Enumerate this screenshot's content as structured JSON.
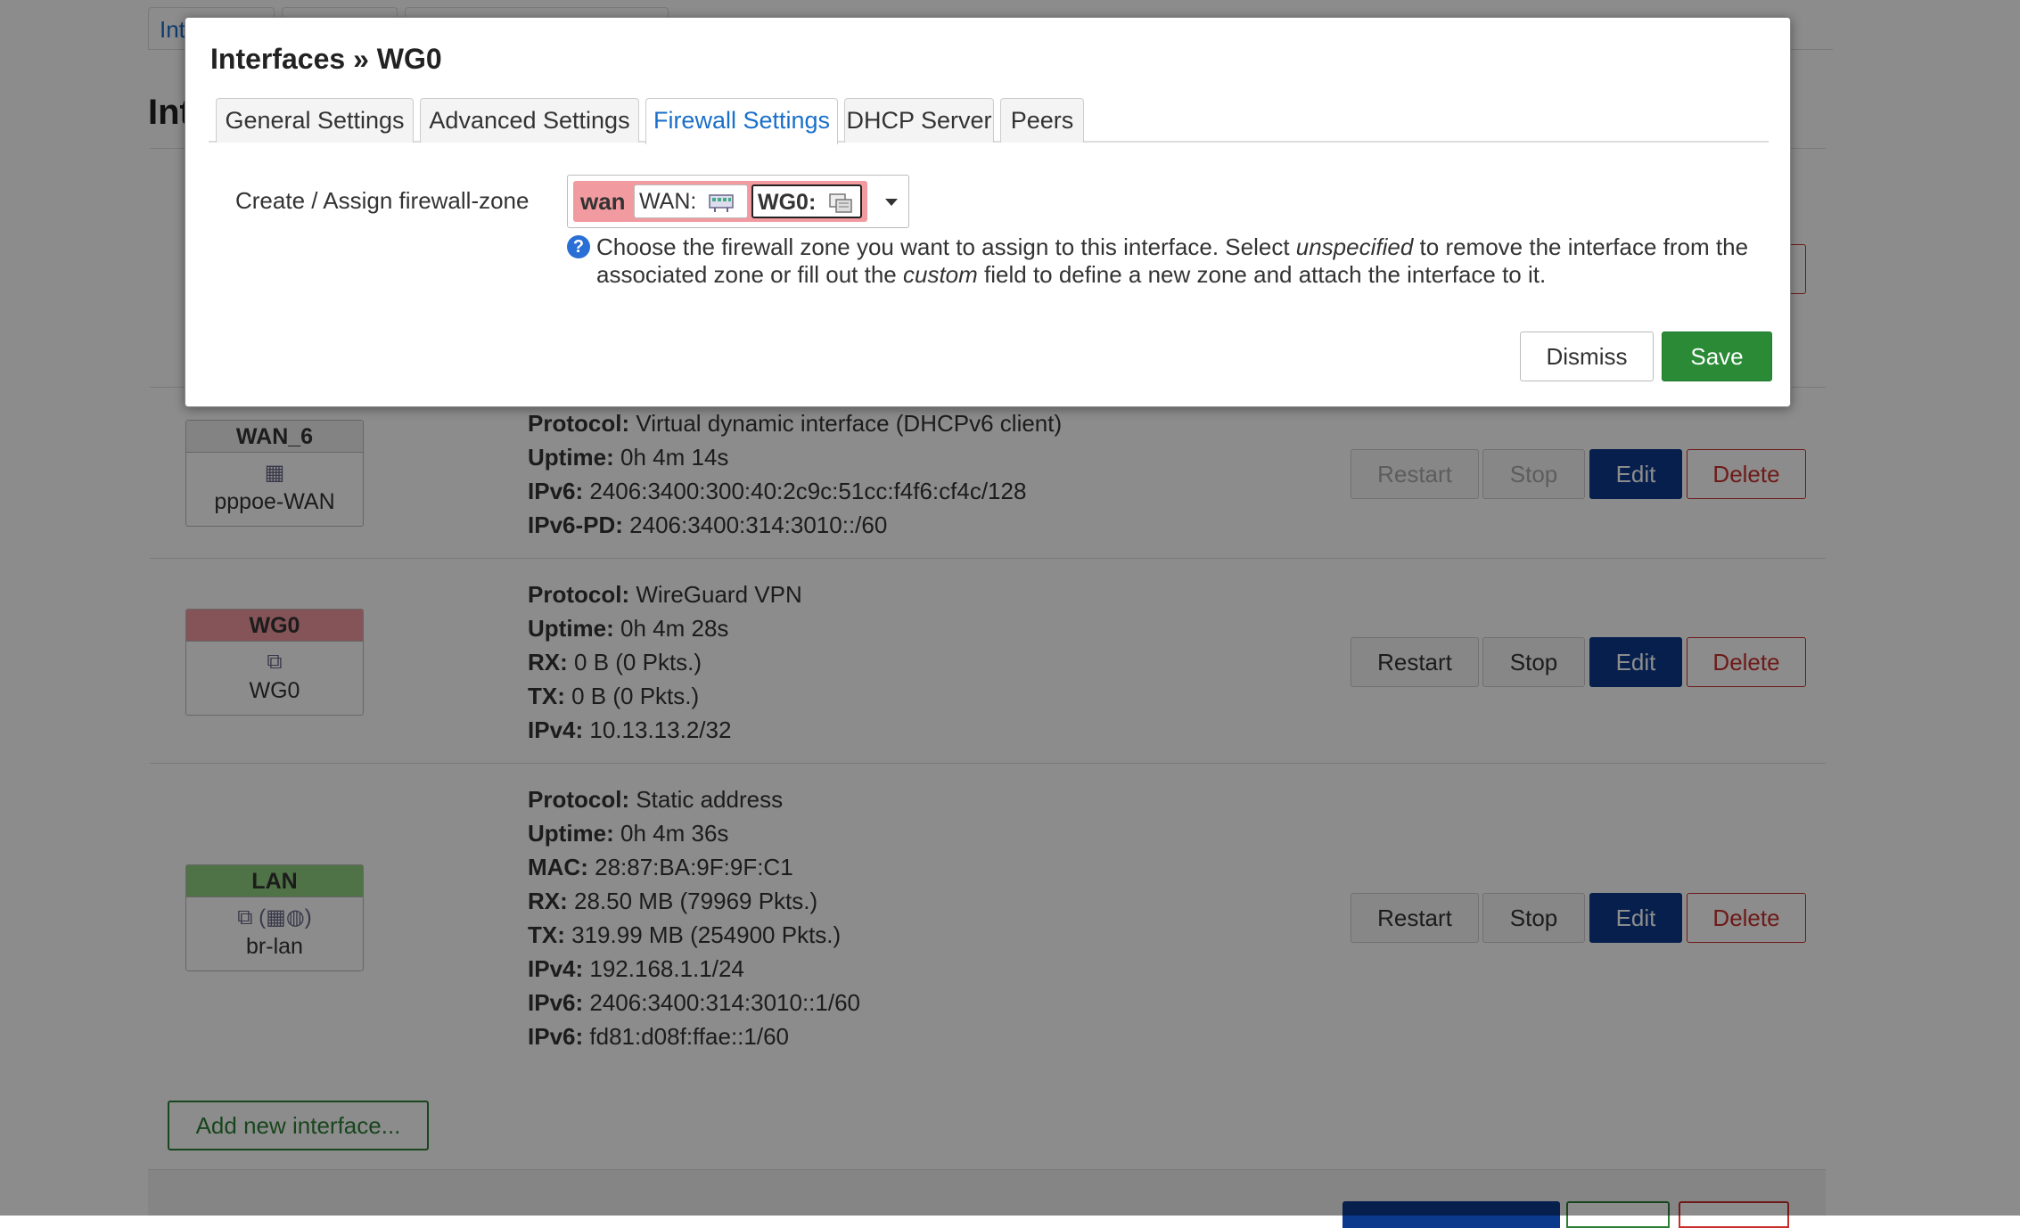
{
  "top_tabs": [
    {
      "label": "Int"
    },
    {
      "label": ""
    },
    {
      "label": ""
    }
  ],
  "page_title": "Int",
  "interfaces": [
    {
      "name": "WAN_6",
      "head_color": "#eeeeee",
      "icon": "network-icon",
      "device": "pppoe-WAN",
      "info": [
        {
          "k": "Protocol:",
          "v": "Virtual dynamic interface (DHCPv6 client)"
        },
        {
          "k": "Uptime:",
          "v": "0h 4m 14s"
        },
        {
          "k": "IPv6:",
          "v": "2406:3400:300:40:2c9c:51cc:f4f6:cf4c/128"
        },
        {
          "k": "IPv6-PD:",
          "v": "2406:3400:314:3010::/60"
        }
      ],
      "restart_disabled": true,
      "stop_disabled": true
    },
    {
      "name": "WG0",
      "head_color": "#f19aa0",
      "icon": "tunnel-icon",
      "device": "WG0",
      "info": [
        {
          "k": "Protocol:",
          "v": "WireGuard VPN"
        },
        {
          "k": "Uptime:",
          "v": "0h 4m 28s"
        },
        {
          "k": "RX:",
          "v": "0 B (0 Pkts.)"
        },
        {
          "k": "TX:",
          "v": "0 B (0 Pkts.)"
        },
        {
          "k": "IPv4:",
          "v": "10.13.13.2/32"
        }
      ],
      "restart_disabled": false,
      "stop_disabled": false
    },
    {
      "name": "LAN",
      "head_color": "#90d080",
      "icon": "bridge-icon",
      "device": "br-lan",
      "info": [
        {
          "k": "Protocol:",
          "v": "Static address"
        },
        {
          "k": "Uptime:",
          "v": "0h 4m 36s"
        },
        {
          "k": "MAC:",
          "v": "28:87:BA:9F:9F:C1"
        },
        {
          "k": "RX:",
          "v": "28.50 MB (79969 Pkts.)"
        },
        {
          "k": "TX:",
          "v": "319.99 MB (254900 Pkts.)"
        },
        {
          "k": "IPv4:",
          "v": "192.168.1.1/24"
        },
        {
          "k": "IPv6:",
          "v": "2406:3400:314:3010::1/60"
        },
        {
          "k": "IPv6:",
          "v": "fd81:d08f:ffae::1/60"
        }
      ],
      "restart_disabled": false,
      "stop_disabled": false
    }
  ],
  "row_buttons": {
    "restart": "Restart",
    "stop": "Stop",
    "edit": "Edit",
    "delete": "Delete"
  },
  "add_interface_label": "Add new interface...",
  "modal": {
    "title": "Interfaces » WG0",
    "tabs": [
      {
        "label": "General Settings",
        "active": false
      },
      {
        "label": "Advanced Settings",
        "active": false
      },
      {
        "label": "Firewall Settings",
        "active": true
      },
      {
        "label": "DHCP Server",
        "active": false
      },
      {
        "label": "Peers",
        "active": false
      }
    ],
    "field_label": "Create / Assign firewall-zone",
    "zone": {
      "name": "wan",
      "color": "#f19aa0",
      "networks": [
        {
          "label": "WAN:",
          "icon": "ethernet-icon",
          "selected": false
        },
        {
          "label": "WG0:",
          "icon": "tunnel-icon",
          "selected": true
        }
      ]
    },
    "help": {
      "part1": "Choose the firewall zone you want to assign to this interface. Select ",
      "em1": "unspecified",
      "part2": " to remove the interface from the associated zone or fill out the ",
      "em2": "custom",
      "part3": " field to define a new zone and attach the interface to it."
    },
    "dismiss_label": "Dismiss",
    "save_label": "Save"
  },
  "colors": {
    "accent": "#1a6fc9",
    "edit": "#0b3a8c",
    "delete": "#c9302c",
    "save": "#2a8a36"
  }
}
